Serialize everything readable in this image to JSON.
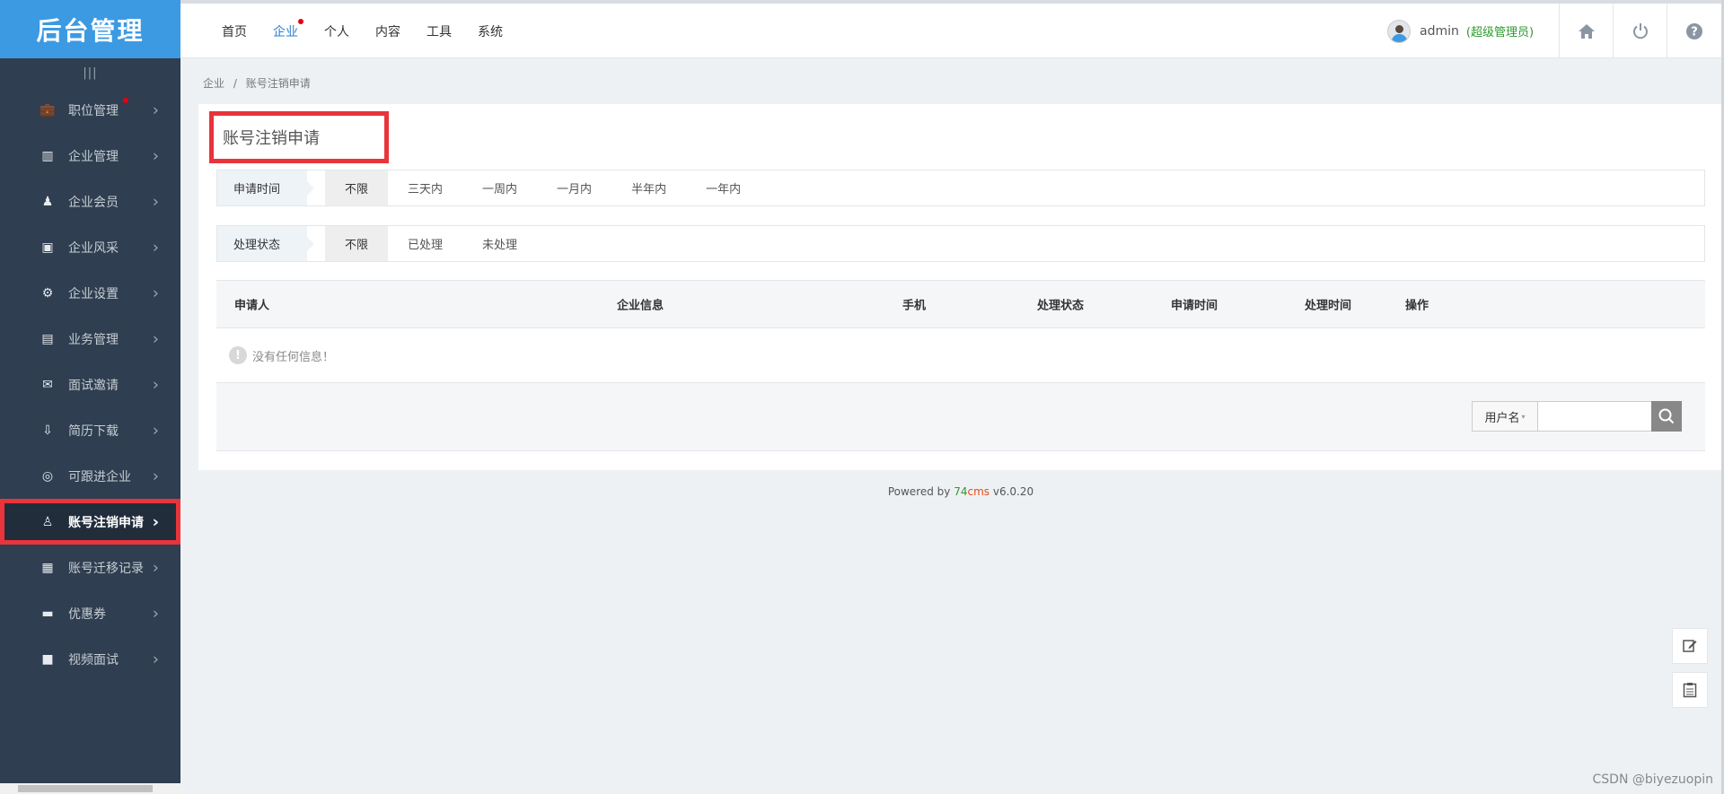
{
  "logo": "后台管理",
  "sidebar": {
    "collapse_glyph": "|||",
    "items": [
      {
        "label": "职位管理",
        "icon": "briefcase-icon",
        "glyph": "💼",
        "dot": true
      },
      {
        "label": "企业管理",
        "icon": "building-icon",
        "glyph": "▥"
      },
      {
        "label": "企业会员",
        "icon": "member-icon",
        "glyph": "♟"
      },
      {
        "label": "企业风采",
        "icon": "image-icon",
        "glyph": "▣"
      },
      {
        "label": "企业设置",
        "icon": "gear-icon",
        "glyph": "⚙"
      },
      {
        "label": "业务管理",
        "icon": "clipboard-icon",
        "glyph": "▤"
      },
      {
        "label": "面试邀请",
        "icon": "envelope-icon",
        "glyph": "✉"
      },
      {
        "label": "简历下载",
        "icon": "download-icon",
        "glyph": "⇩"
      },
      {
        "label": "可跟进企业",
        "icon": "target-icon",
        "glyph": "◎"
      },
      {
        "label": "账号注销申请",
        "icon": "cleanup-icon",
        "glyph": "♙",
        "active": true
      },
      {
        "label": "账号迁移记录",
        "icon": "calendar-icon",
        "glyph": "▦"
      },
      {
        "label": "优惠券",
        "icon": "ticket-icon",
        "glyph": "▬"
      },
      {
        "label": "视频面试",
        "icon": "video-icon",
        "glyph": "■"
      }
    ],
    "arrow": "›"
  },
  "topnav": {
    "items": [
      "首页",
      "企业",
      "个人",
      "内容",
      "工具",
      "系统"
    ],
    "active_index": 1
  },
  "user": {
    "name": "admin",
    "role": "(超级管理员)"
  },
  "breadcrumb": {
    "root": "企业",
    "sep": "/",
    "current": "账号注销申请"
  },
  "page_title": "账号注销申请",
  "filters": {
    "time": {
      "label": "申请时间",
      "options": [
        "不限",
        "三天内",
        "一周内",
        "一月内",
        "半年内",
        "一年内"
      ],
      "selected": "不限"
    },
    "status": {
      "label": "处理状态",
      "options": [
        "不限",
        "已处理",
        "未处理"
      ],
      "selected": "不限"
    }
  },
  "table": {
    "columns": [
      "申请人",
      "企业信息",
      "手机",
      "处理状态",
      "申请时间",
      "处理时间",
      "操作"
    ],
    "empty_icon": "!",
    "empty_text": "没有任何信息！"
  },
  "search": {
    "field": "用户名",
    "caret": "▾",
    "value": ""
  },
  "footer": {
    "prefix": "Powered by ",
    "brand_num": "74",
    "brand_txt": "cms",
    "version": " v6.0.20"
  },
  "watermark": "CSDN @biyezuopin",
  "colors": {
    "accent": "#3c9ae3",
    "sidebar_bg": "#2f3e50",
    "highlight": "#e8343a",
    "active_nav": "#2a7fd2"
  }
}
